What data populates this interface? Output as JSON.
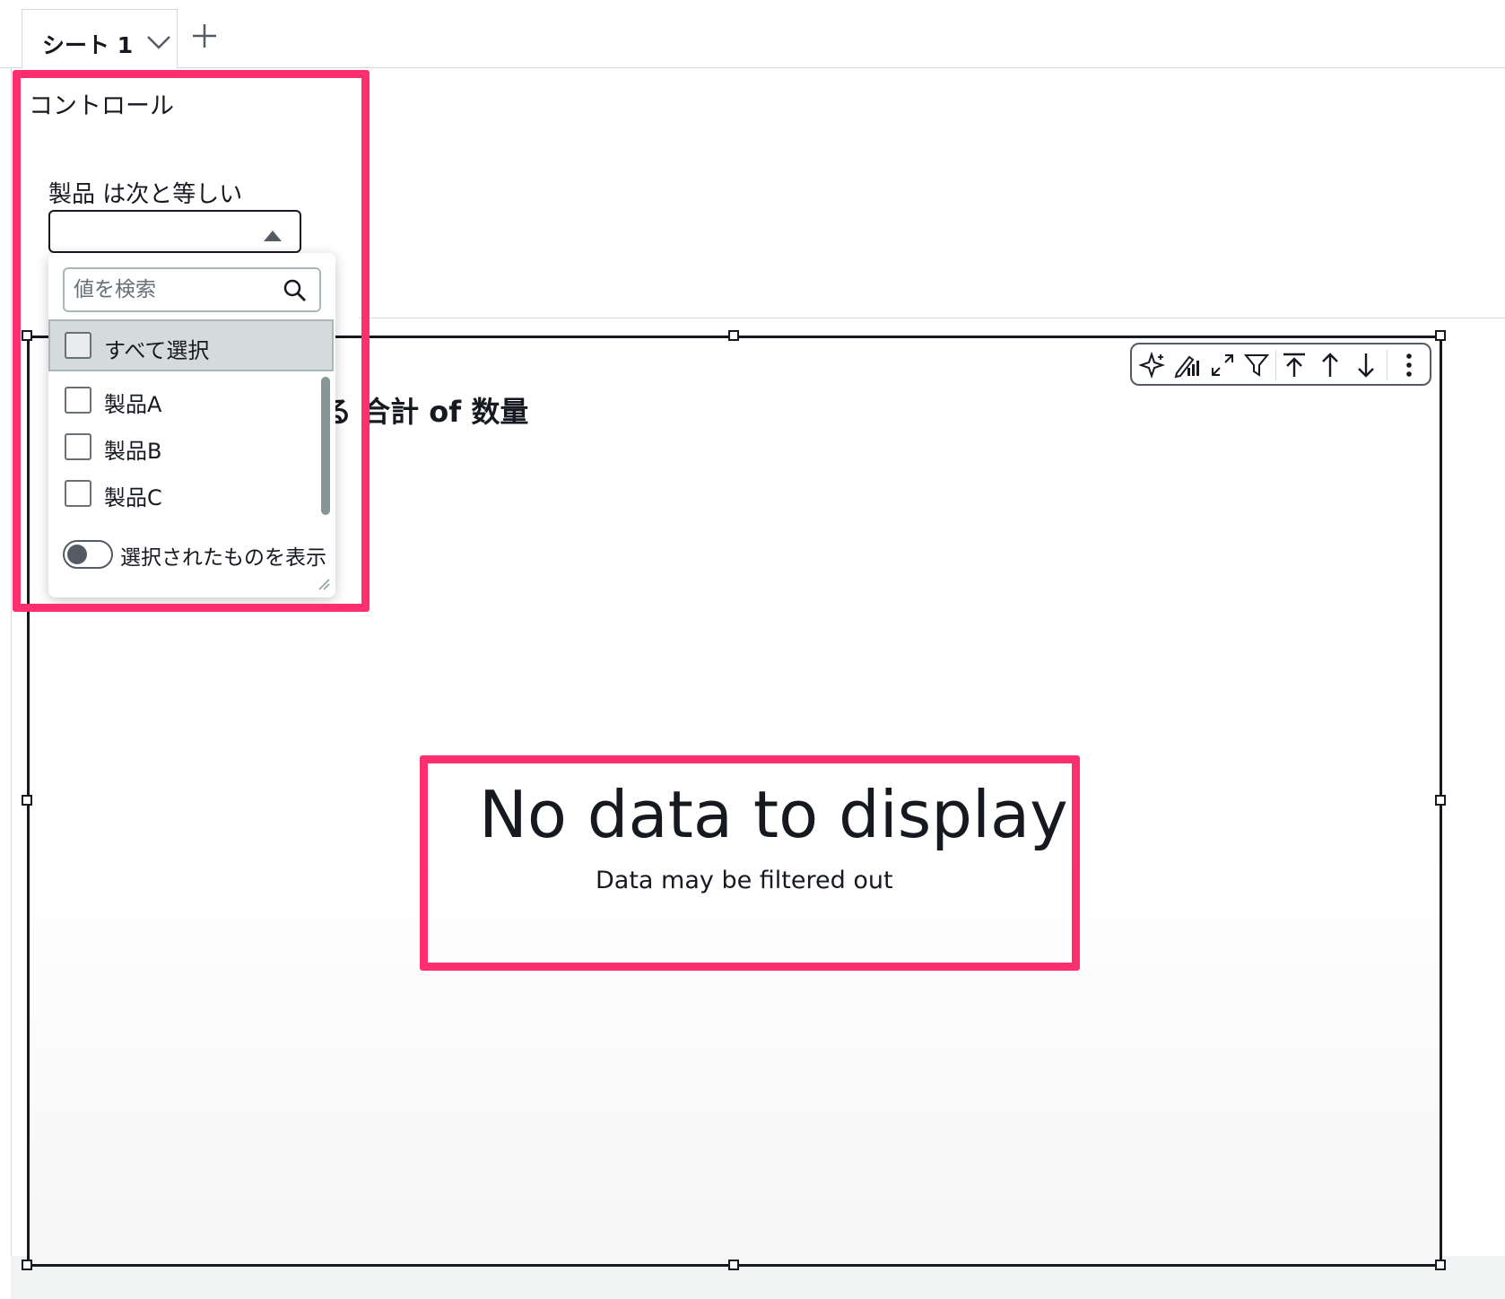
{
  "tabs": {
    "sheet_label": "シート 1"
  },
  "control": {
    "title": "コントロール",
    "filter_label": "製品 は次と等しい",
    "selected_value": "",
    "search_placeholder": "値を検索",
    "select_all_label": "すべて選択",
    "options": [
      "製品A",
      "製品B",
      "製品C"
    ],
    "show_selected_label": "選択されたものを表示",
    "show_selected_on": false
  },
  "visual": {
    "title_visible": "る 合計 of 数量",
    "empty_title": "No data to display",
    "empty_subtitle": "Data may be filtered out"
  },
  "icons": {
    "toolbar": [
      "sparkle-icon",
      "format-visual-icon",
      "expand-icon",
      "filter-icon",
      "move-to-top-icon",
      "move-up-icon",
      "move-down-icon",
      "more-options-icon"
    ]
  },
  "colors": {
    "annotation": "#ff2e6f",
    "border": "#16191f",
    "selectall_bg": "#d5dbdb"
  }
}
